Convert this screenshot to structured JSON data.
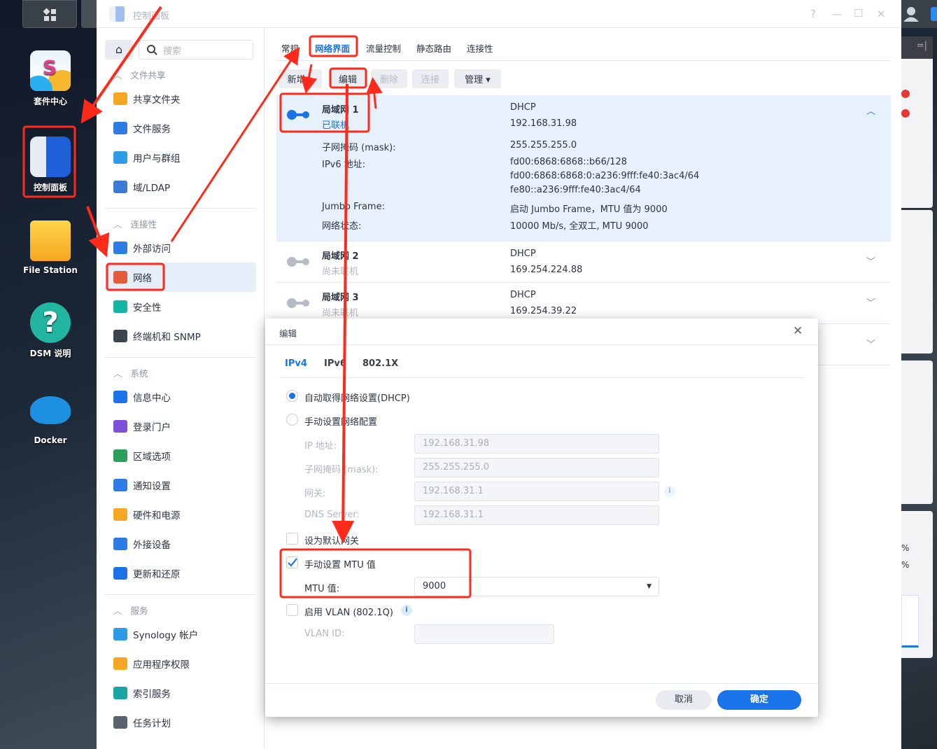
{
  "desktop": {
    "icons": [
      {
        "label": "套件中心"
      },
      {
        "label": "控制面板"
      },
      {
        "label": "File Station"
      },
      {
        "label": "DSM 说明"
      },
      {
        "label": "Docker"
      }
    ]
  },
  "window": {
    "title": "控制面板",
    "controls": [
      "?",
      "—",
      "☐",
      "✕"
    ]
  },
  "sidebar": {
    "search_placeholder": "搜索",
    "groups": [
      {
        "label": "文件共享",
        "items": [
          "共享文件夹",
          "文件服务",
          "用户与群组",
          "域/LDAP"
        ]
      },
      {
        "label": "连接性",
        "items": [
          "外部访问",
          "网络",
          "安全性",
          "终端机和 SNMP"
        ]
      },
      {
        "label": "系统",
        "items": [
          "信息中心",
          "登录门户",
          "区域选项",
          "通知设置",
          "硬件和电源",
          "外接设备",
          "更新和还原"
        ]
      },
      {
        "label": "服务",
        "items": [
          "Synology 帐户",
          "应用程序权限",
          "索引服务",
          "任务计划"
        ]
      }
    ],
    "selected": "网络",
    "icon_colors": [
      "#f5a623",
      "#2d7be5",
      "#2d9be5",
      "#3a7bd5",
      "#2d7be5",
      "#e55b3a",
      "#13b5a5",
      "#3c4450",
      "#1a73e8",
      "#7b4fd6",
      "#2aa05a",
      "#2d7be5",
      "#f5a623",
      "#2d7be5",
      "#1a73e8",
      "#2d9be5",
      "#f5a623",
      "#1aa5a5",
      "#5a6470"
    ]
  },
  "main": {
    "tabs": [
      "常规",
      "网络界面",
      "流量控制",
      "静态路由",
      "连接性"
    ],
    "active_tab": "网络界面",
    "toolbar": {
      "add": "新增 ▾",
      "edit": "编辑",
      "delete": "删除",
      "connect": "连接",
      "manage": "管理 ▾"
    },
    "interfaces": [
      {
        "name": "局域网 1",
        "status": "已联机",
        "mode": "DHCP",
        "ip": "192.168.31.98",
        "expanded": true,
        "details": [
          {
            "label": "子网掩码 (mask):",
            "value": [
              "255.255.255.0"
            ]
          },
          {
            "label": "IPv6 地址:",
            "value": [
              "fd00:6868:6868::b66/128",
              "fd00:6868:6868:0:a236:9fff:fe40:3ac4/64",
              "fe80::a236:9fff:fe40:3ac4/64"
            ]
          },
          {
            "label": "Jumbo Frame:",
            "value": [
              "启动 Jumbo Frame，MTU 值为 9000"
            ]
          },
          {
            "label": "网络状态:",
            "value": [
              "10000 Mb/s, 全双工, MTU 9000"
            ]
          }
        ]
      },
      {
        "name": "局域网 2",
        "status": "尚未联机",
        "mode": "DHCP",
        "ip": "169.254.224.88"
      },
      {
        "name": "局域网 3",
        "status": "尚未联机",
        "mode": "DHCP",
        "ip": "169.254.39.22"
      }
    ]
  },
  "dialog": {
    "title": "编辑",
    "tabs": [
      "IPv4",
      "IPv6",
      "802.1X"
    ],
    "active_tab": "IPv4",
    "radio_dhcp": "自动取得网络设置(DHCP)",
    "radio_manual": "手动设置网络配置",
    "fields": [
      {
        "label": "IP 地址:",
        "value": "192.168.31.98"
      },
      {
        "label": "子网掩码 (mask):",
        "value": "255.255.255.0"
      },
      {
        "label": "网关:",
        "value": "192.168.31.1"
      },
      {
        "label": "DNS Server:",
        "value": "192.168.31.1"
      }
    ],
    "default_gateway": "设为默认网关",
    "manual_mtu": "手动设置 MTU 值",
    "manual_mtu_checked": true,
    "mtu_label": "MTU 值:",
    "mtu_value": "9000",
    "vlan": "启用 VLAN (802.1Q)",
    "vlan_id_label": "VLAN ID:",
    "vlan_id_value": "",
    "info_glyph": "i",
    "cancel": "取消",
    "ok": "确定"
  },
  "colors": {
    "accent": "#1a73e8",
    "selected_row": "#e6f1fc",
    "annotation": "#ff2a1a"
  }
}
